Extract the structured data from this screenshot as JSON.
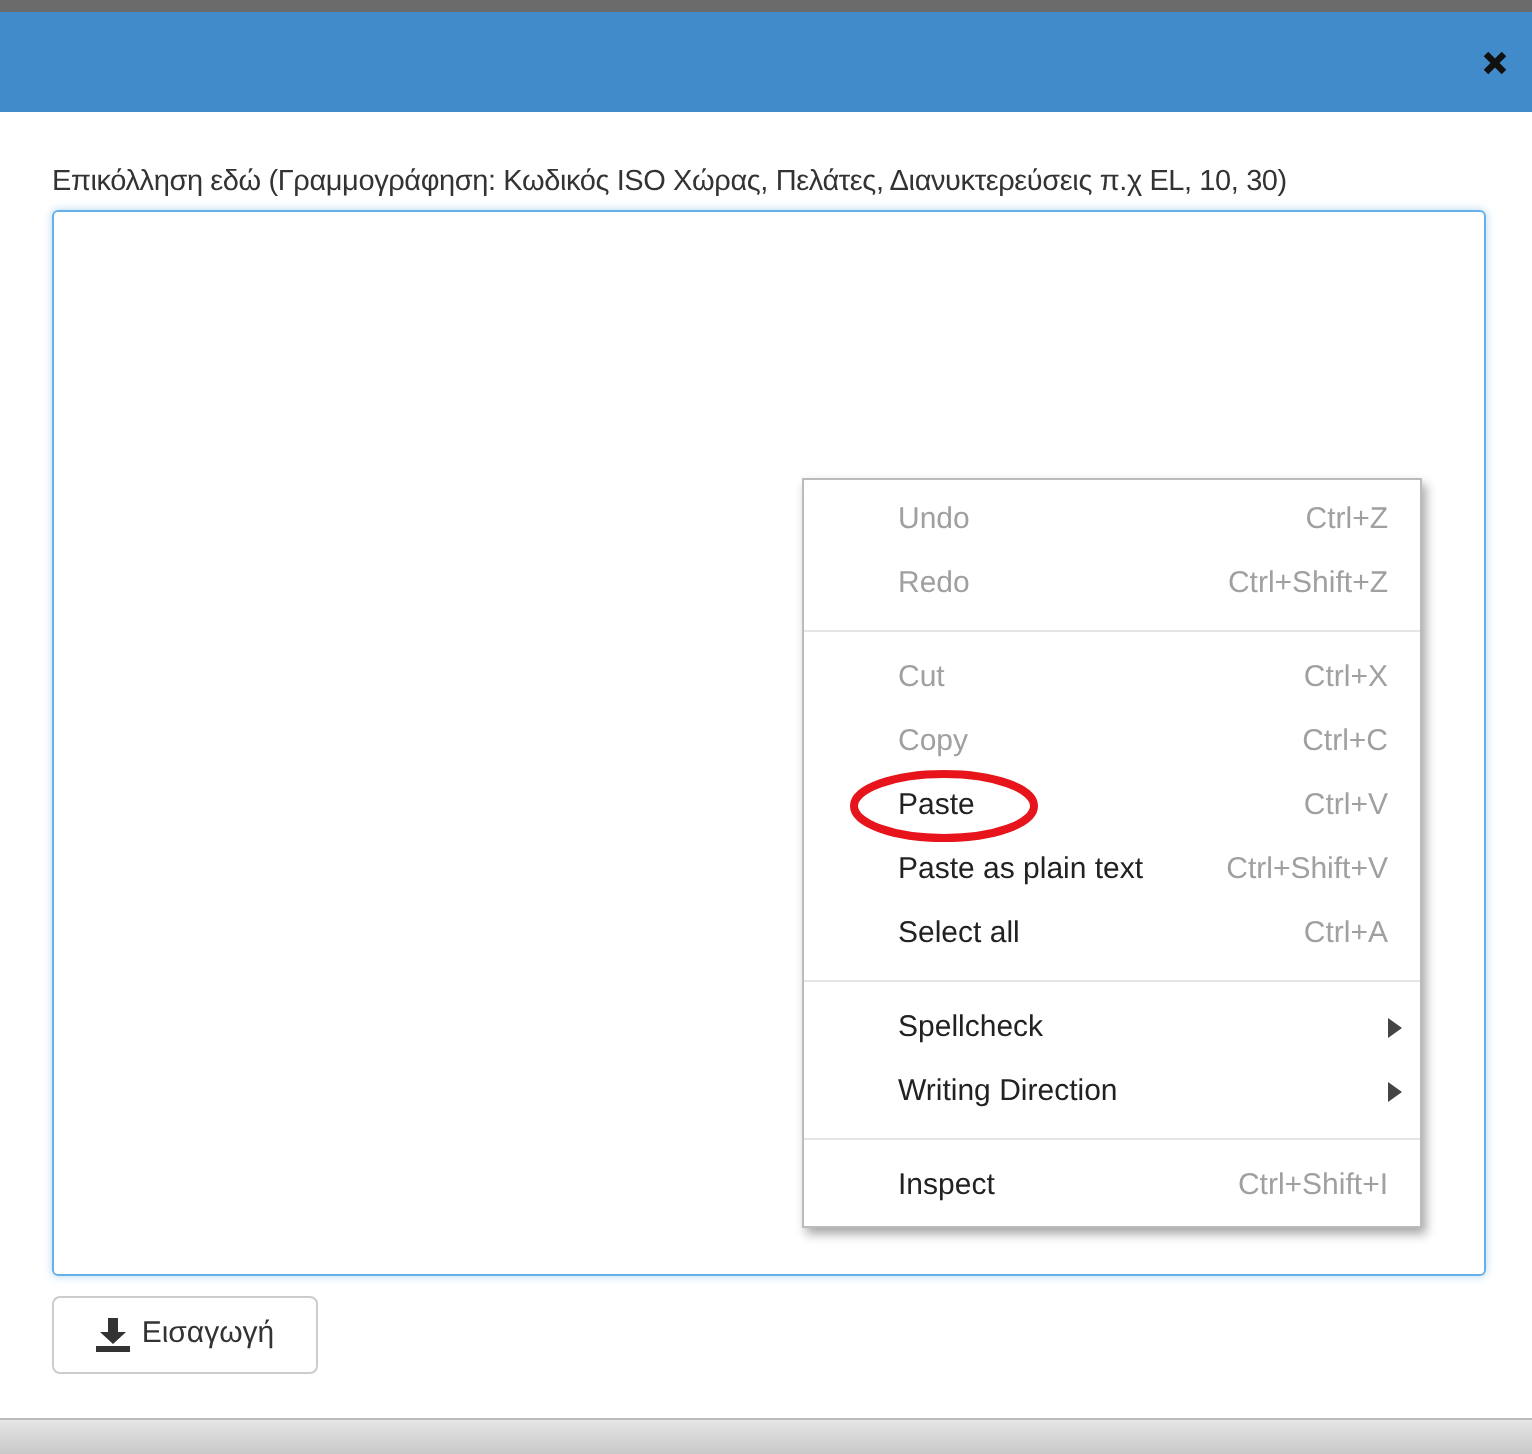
{
  "dialog": {
    "label": "Επικόλληση εδώ (Γραμμογράφηση: Κωδικός ISO Χώρας, Πελάτες, Διανυκτερεύσεις π.χ EL, 10, 30)",
    "import_button": "Εισαγωγή"
  },
  "context_menu": [
    {
      "kind": "item",
      "label": "Undo",
      "shortcut": "Ctrl+Z",
      "disabled": true,
      "circled": false,
      "submenu": false
    },
    {
      "kind": "item",
      "label": "Redo",
      "shortcut": "Ctrl+Shift+Z",
      "disabled": true,
      "circled": false,
      "submenu": false
    },
    {
      "kind": "separator"
    },
    {
      "kind": "item",
      "label": "Cut",
      "shortcut": "Ctrl+X",
      "disabled": true,
      "circled": false,
      "submenu": false
    },
    {
      "kind": "item",
      "label": "Copy",
      "shortcut": "Ctrl+C",
      "disabled": true,
      "circled": false,
      "submenu": false
    },
    {
      "kind": "item",
      "label": "Paste",
      "shortcut": "Ctrl+V",
      "disabled": false,
      "circled": true,
      "submenu": false
    },
    {
      "kind": "item",
      "label": "Paste as plain text",
      "shortcut": "Ctrl+Shift+V",
      "disabled": false,
      "circled": false,
      "submenu": false
    },
    {
      "kind": "item",
      "label": "Select all",
      "shortcut": "Ctrl+A",
      "disabled": false,
      "circled": false,
      "submenu": false
    },
    {
      "kind": "separator"
    },
    {
      "kind": "item",
      "label": "Spellcheck",
      "disabled": false,
      "circled": false,
      "submenu": true
    },
    {
      "kind": "item",
      "label": "Writing Direction",
      "disabled": false,
      "circled": false,
      "submenu": true
    },
    {
      "kind": "separator"
    },
    {
      "kind": "item",
      "label": "Inspect",
      "shortcut": "Ctrl+Shift+I",
      "disabled": false,
      "circled": false,
      "submenu": false
    }
  ]
}
